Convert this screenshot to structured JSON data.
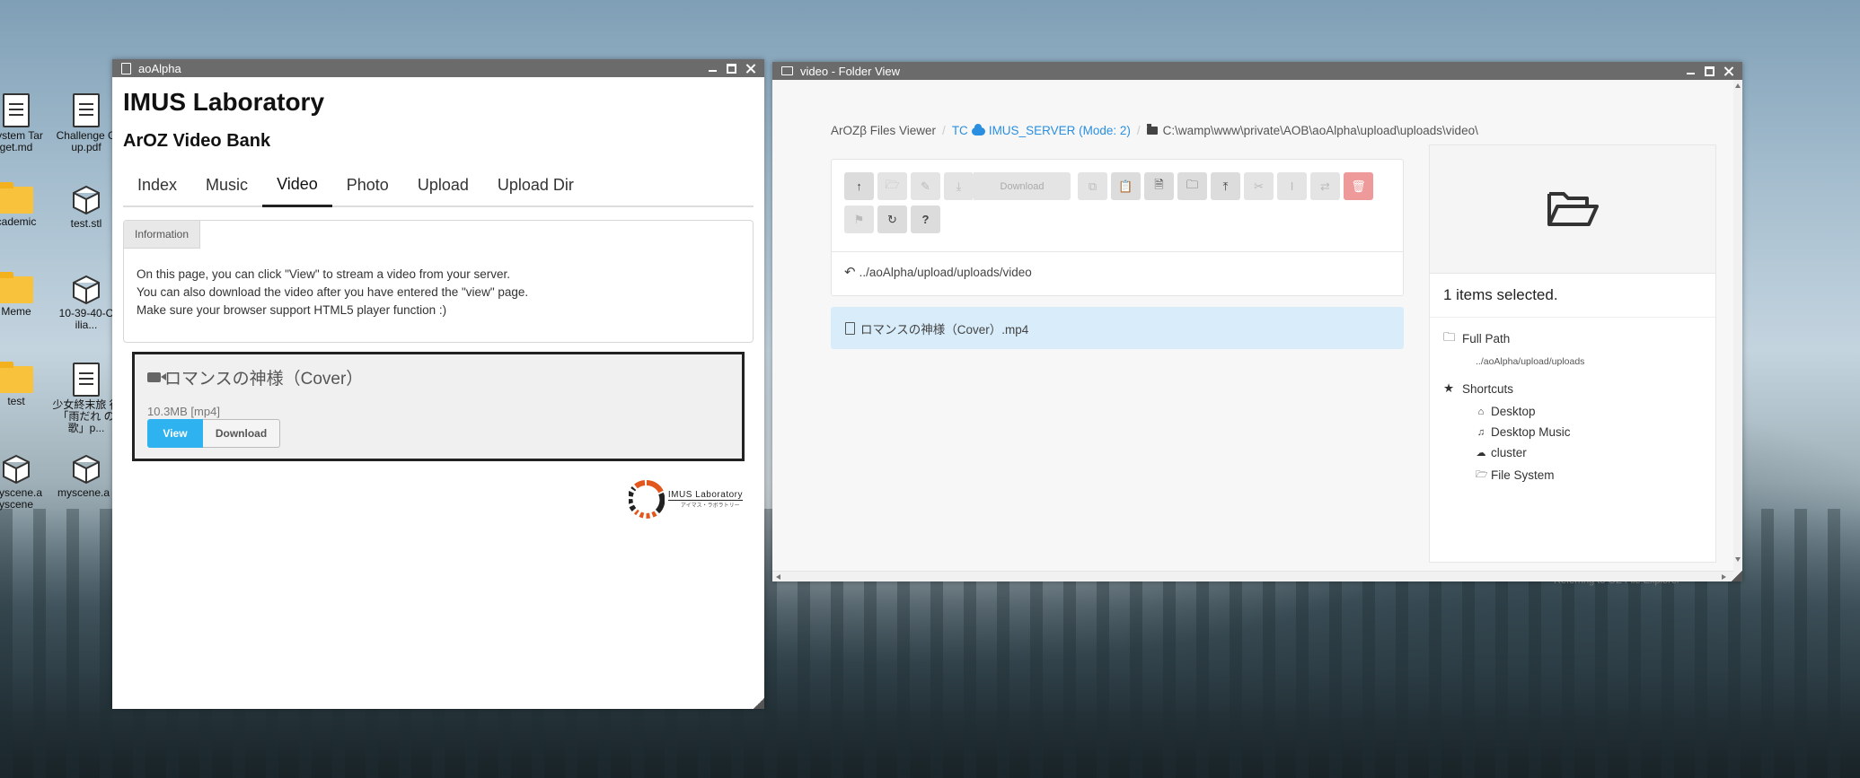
{
  "desktop": {
    "icons": [
      {
        "label": "System Tar get.md",
        "type": "document"
      },
      {
        "label": "Challenge G up.pdf",
        "type": "document"
      },
      {
        "label": "cademic",
        "type": "folder"
      },
      {
        "label": "test.stl",
        "type": "cube"
      },
      {
        "label": "Meme",
        "type": "folder"
      },
      {
        "label": "10-39-40-C ilia...",
        "type": "cube"
      },
      {
        "label": "test",
        "type": "folder"
      },
      {
        "label": "少女終末旅 行「雨だれ の歌」p...",
        "type": "document"
      },
      {
        "label": "myscene.a yscene",
        "type": "cube"
      },
      {
        "label": "myscene.a l",
        "type": "cube"
      }
    ]
  },
  "window_aoalpha": {
    "title": "aoAlpha",
    "heading": "IMUS Laboratory",
    "subheading": "ArOZ Video Bank",
    "menu": [
      {
        "label": "Index",
        "active": false
      },
      {
        "label": "Music",
        "active": false
      },
      {
        "label": "Video",
        "active": true
      },
      {
        "label": "Photo",
        "active": false
      },
      {
        "label": "Upload",
        "active": false
      },
      {
        "label": "Upload Dir",
        "active": false
      }
    ],
    "info_label": "Information",
    "info_lines": [
      "On this page, you can click \"View\" to stream a video from your server.",
      "You can also download the video after you have entered the \"view\" page.",
      "Make sure your browser support HTML5 player function :)"
    ],
    "video": {
      "title": "ロマンスの神様（Cover）",
      "meta": "10.3MB [mp4]",
      "view_label": "View",
      "download_label": "Download"
    },
    "logo_text": "IMUS Laboratory",
    "logo_subtext": "アイマス・ラボラトリー"
  },
  "window_folder": {
    "title": "video - Folder View",
    "breadcrumb": {
      "root": "ArOZβ Files Viewer",
      "server_prefix": "TC",
      "server": "IMUS_SERVER (Mode: 2)",
      "path": "C:\\wamp\\www\\private\\AOB\\aoAlpha\\upload\\uploads\\video\\"
    },
    "toolbar": {
      "download_label": "Download",
      "row1_icons": [
        "arrow-up-icon",
        "folder-open-icon",
        "edit-icon",
        "download-icon",
        "copy-icon",
        "paste-icon",
        "new-file-icon",
        "new-folder-icon",
        "upload-icon",
        "cut-icon",
        "rename-icon",
        "move-icon",
        "trash-icon"
      ],
      "row2_icons": [
        "bookmark-icon",
        "refresh-icon",
        "help-icon"
      ],
      "help_label": "?"
    },
    "current_path": "../aoAlpha/upload/uploads/video",
    "files": [
      {
        "name": "ロマンスの神様（Cover）.mp4",
        "selected": true
      }
    ],
    "sidebar": {
      "selection": "1 items selected.",
      "full_path_label": "Full Path",
      "full_path_value": "../aoAlpha/upload/uploads",
      "shortcuts_label": "Shortcuts",
      "shortcuts": [
        {
          "label": "Desktop",
          "icon": "home-icon"
        },
        {
          "label": "Desktop Music",
          "icon": "music-icon"
        },
        {
          "label": "cluster",
          "icon": "cloud-icon"
        },
        {
          "label": "File System",
          "icon": "folder-open-icon"
        }
      ]
    },
    "footer_peek": "Referring to OZ File Explorer"
  },
  "colors": {
    "accent_blue": "#2eb3f0",
    "link_blue": "#2a8fe0",
    "selected_row": "#d8ecfa",
    "delete_red": "#ef9a9a",
    "titlebar": "#6b6b6b"
  }
}
